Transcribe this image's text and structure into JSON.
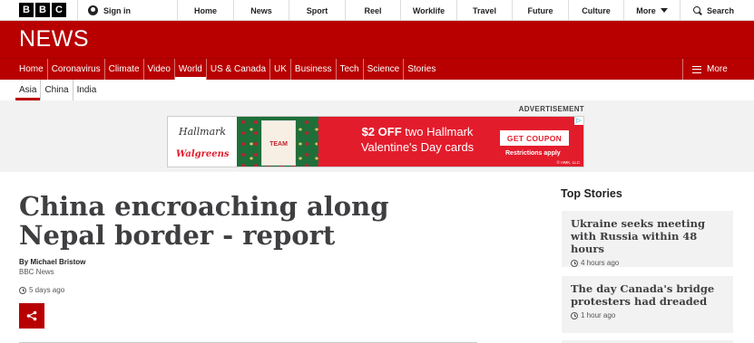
{
  "header": {
    "logo_letters": [
      "B",
      "B",
      "C"
    ],
    "signin_label": "Sign in",
    "nav": [
      "Home",
      "News",
      "Sport",
      "Reel",
      "Worklife",
      "Travel",
      "Future",
      "Culture"
    ],
    "more_label": "More",
    "search_label": "Search"
  },
  "brand": {
    "title": "NEWS",
    "color": "#b80000"
  },
  "main_nav": {
    "items": [
      "Home",
      "Coronavirus",
      "Climate",
      "Video",
      "World",
      "US & Canada",
      "UK",
      "Business",
      "Tech",
      "Science",
      "Stories"
    ],
    "active": "World",
    "more_label": "More"
  },
  "sub_nav": {
    "items": [
      "Asia",
      "China",
      "India"
    ],
    "active": "Asia"
  },
  "ad": {
    "label": "ADVERTISEMENT",
    "brand1": "Hallmark",
    "brand2": "Walgreens",
    "card_text": "TEAM",
    "headline_bold": "$2 OFF",
    "headline_rest": " two Hallmark Valentine's Day cards",
    "button": "GET COUPON",
    "restrictions": "Restrictions apply",
    "small_print": "© HMK, LLC"
  },
  "article": {
    "headline": "China encroaching along Nepal border - report",
    "byline": "By Michael Bristow",
    "source": "BBC News",
    "timestamp": "5 days ago"
  },
  "sidebar": {
    "title": "Top Stories",
    "stories": [
      {
        "title": "Ukraine seeks meeting with Russia within 48 hours",
        "time": "4 hours ago"
      },
      {
        "title": "The day Canada's bridge protesters had dreaded",
        "time": "1 hour ago"
      }
    ]
  }
}
